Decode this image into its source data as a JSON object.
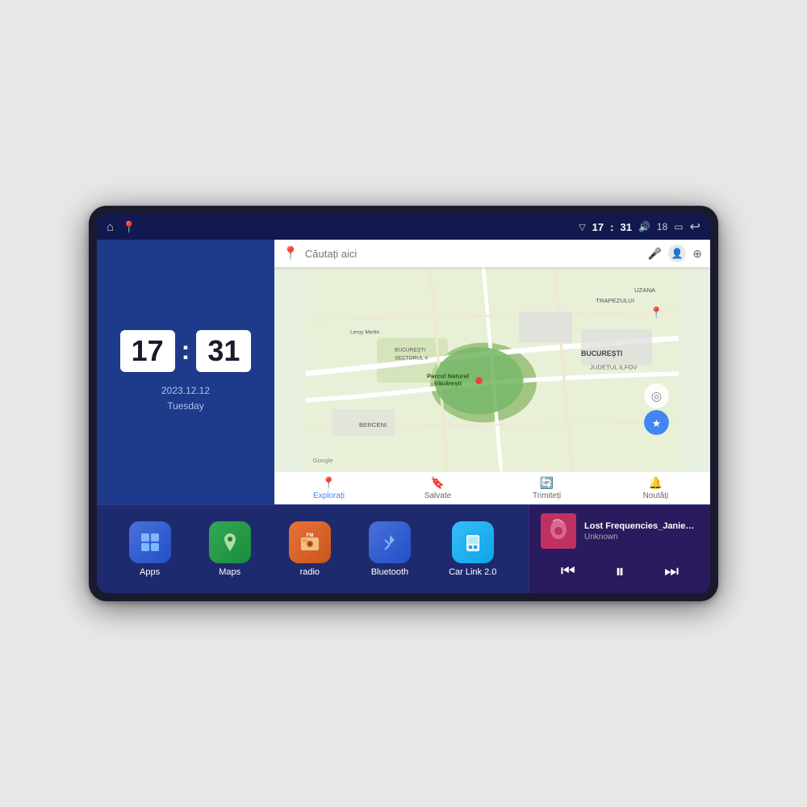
{
  "device": {
    "status_bar": {
      "left_icons": [
        "home-icon",
        "maps-pin-icon"
      ],
      "signal_icon": "▽",
      "time": "17:31",
      "volume_icon": "🔊",
      "battery_level": "18",
      "battery_icon": "🔋",
      "back_icon": "↩"
    },
    "clock": {
      "hours": "17",
      "minutes": "31",
      "date": "2023.12.12",
      "day": "Tuesday"
    },
    "map": {
      "search_placeholder": "Căutați aici",
      "location_labels": [
        "Parcul Natural Văcărești",
        "BUCUREȘTI",
        "JUDEȚUL ILFOV",
        "Leroy Merlin",
        "BERCENI",
        "TRAPEZULUI",
        "BUCUREȘTI SECTORUL 4"
      ],
      "bottom_items": [
        {
          "label": "Explorați",
          "icon": "📍",
          "active": true
        },
        {
          "label": "Salvate",
          "icon": "🔖",
          "active": false
        },
        {
          "label": "Trimiteți",
          "icon": "🔄",
          "active": false
        },
        {
          "label": "Noutăți",
          "icon": "🔔",
          "active": false
        }
      ]
    },
    "apps": [
      {
        "id": "apps",
        "label": "Apps",
        "icon": "⊞",
        "color_class": "icon-apps"
      },
      {
        "id": "maps",
        "label": "Maps",
        "icon": "📍",
        "color_class": "icon-maps"
      },
      {
        "id": "radio",
        "label": "radio",
        "icon": "📻",
        "color_class": "icon-radio"
      },
      {
        "id": "bluetooth",
        "label": "Bluetooth",
        "icon": "🔵",
        "color_class": "icon-bluetooth"
      },
      {
        "id": "carlink",
        "label": "Car Link 2.0",
        "icon": "📱",
        "color_class": "icon-carlink"
      }
    ],
    "music": {
      "title": "Lost Frequencies_Janieck Devy-...",
      "artist": "Unknown",
      "controls": {
        "prev": "⏮",
        "play": "⏸",
        "next": "⏭"
      }
    }
  }
}
